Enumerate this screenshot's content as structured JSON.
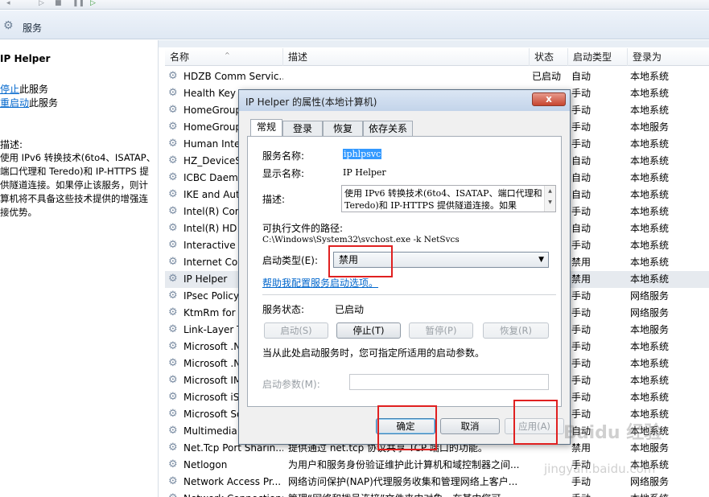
{
  "app": {
    "title": "服务"
  },
  "left": {
    "service_name": "IP Helper",
    "action_stop_link": "停止",
    "action_stop_suffix": "此服务",
    "action_restart_link": "重启动",
    "action_restart_suffix": "此服务",
    "desc_label": "描述:",
    "desc_text": "使用 IPv6 转换技术(6to4、ISATAP、端口代理和 Teredo)和 IP-HTTPS 提供隧道连接。如果停止该服务，则计算机将不具备这些技术提供的增强连接优势。"
  },
  "columns": {
    "name": "名称",
    "desc": "描述",
    "status": "状态",
    "startup": "启动类型",
    "logon": "登录为"
  },
  "services": [
    {
      "name": "HDZB Comm Servic...",
      "desc": "",
      "status": "已启动",
      "startup": "自动",
      "logon": "本地系统"
    },
    {
      "name": "Health Key a",
      "desc": "",
      "status": "",
      "startup": "手动",
      "logon": "本地系统"
    },
    {
      "name": "HomeGroup",
      "desc": "",
      "status": "",
      "startup": "手动",
      "logon": "本地系统"
    },
    {
      "name": "HomeGroup",
      "desc": "",
      "status": "",
      "startup": "手动",
      "logon": "本地服务"
    },
    {
      "name": "Human Inte",
      "desc": "",
      "status": "",
      "startup": "手动",
      "logon": "本地系统"
    },
    {
      "name": "HZ_DeviceSe",
      "desc": "",
      "status": "",
      "startup": "自动",
      "logon": "本地系统"
    },
    {
      "name": "ICBC Daemo",
      "desc": "",
      "status": "",
      "startup": "自动",
      "logon": "本地系统"
    },
    {
      "name": "IKE and Aut",
      "desc": "",
      "status": "",
      "startup": "自动",
      "logon": "本地系统"
    },
    {
      "name": "Intel(R) Con",
      "desc": "",
      "status": "",
      "startup": "手动",
      "logon": "本地系统"
    },
    {
      "name": "Intel(R) HD",
      "desc": "",
      "status": "",
      "startup": "自动",
      "logon": "本地系统"
    },
    {
      "name": "Interactive S",
      "desc": "",
      "status": "",
      "startup": "手动",
      "logon": "本地系统"
    },
    {
      "name": "Internet Cor",
      "desc": "",
      "status": "",
      "startup": "禁用",
      "logon": "本地系统"
    },
    {
      "name": "IP Helper",
      "desc": "",
      "status": "",
      "startup": "禁用",
      "logon": "本地系统"
    },
    {
      "name": "IPsec Policy",
      "desc": "",
      "status": "",
      "startup": "手动",
      "logon": "网络服务"
    },
    {
      "name": "KtmRm for",
      "desc": "",
      "status": "",
      "startup": "手动",
      "logon": "网络服务"
    },
    {
      "name": "Link-Layer T",
      "desc": "",
      "status": "",
      "startup": "手动",
      "logon": "本地服务"
    },
    {
      "name": "Microsoft .N",
      "desc": "",
      "status": "",
      "startup": "手动",
      "logon": "本地系统"
    },
    {
      "name": "Microsoft .N",
      "desc": "",
      "status": "",
      "startup": "手动",
      "logon": "本地系统"
    },
    {
      "name": "Microsoft IM",
      "desc": "",
      "status": "",
      "startup": "手动",
      "logon": "本地系统"
    },
    {
      "name": "Microsoft iS",
      "desc": "",
      "status": "",
      "startup": "手动",
      "logon": "本地系统"
    },
    {
      "name": "Microsoft So",
      "desc": "",
      "status": "",
      "startup": "手动",
      "logon": "本地系统"
    },
    {
      "name": "Multimedia",
      "desc": "",
      "status": "",
      "startup": "自动",
      "logon": "本地系统"
    },
    {
      "name": "Net.Tcp Port Sharin...",
      "desc": "提供通过 net.tcp 协议共享 TCP 端口的功能。",
      "status": "",
      "startup": "禁用",
      "logon": "本地服务"
    },
    {
      "name": "Netlogon",
      "desc": "为用户和服务身份验证维护此计算机和域控制器之间...",
      "status": "",
      "startup": "手动",
      "logon": "本地系统"
    },
    {
      "name": "Network Access Pr...",
      "desc": "网络访问保护(NAP)代理服务收集和管理网络上客户...",
      "status": "",
      "startup": "手动",
      "logon": "网络服务"
    },
    {
      "name": "Network Connections",
      "desc": "管理“网络和拨号连接”文件夹中对象，在其中您可",
      "status": "",
      "startup": "手动",
      "logon": "本地系统"
    }
  ],
  "dialog": {
    "title": "IP Helper 的属性(本地计算机)",
    "close": "x",
    "tabs": [
      "常规",
      "登录",
      "恢复",
      "依存关系"
    ],
    "service_name_label": "服务名称:",
    "service_name": "iphlpsvc",
    "display_name_label": "显示名称:",
    "display_name": "IP Helper",
    "desc_label": "描述:",
    "desc": "使用 IPv6 转换技术(6to4、ISATAP、端口代理和 Teredo)和 IP-HTTPS 提供隧道连接。如果",
    "path_label": "可执行文件的路径:",
    "path": "C:\\Windows\\System32\\svchost.exe -k NetSvcs",
    "startup_label": "启动类型(E):",
    "startup_value": "禁用",
    "help_link": "帮助我配置服务启动选项。",
    "status_label": "服务状态:",
    "status_value": "已启动",
    "btn_start": "启动(S)",
    "btn_stop": "停止(T)",
    "btn_pause": "暂停(P)",
    "btn_resume": "恢复(R)",
    "hint": "当从此处启动服务时，您可指定所适用的启动参数。",
    "param_label": "启动参数(M):",
    "param_value": "",
    "ok": "确定",
    "cancel": "取消",
    "apply": "应用(A)"
  },
  "watermark": {
    "main": "Baidu 经验",
    "sub": "jingyan.baidu.com"
  },
  "colors": {
    "annotation": "#e02020",
    "link": "#0066cc",
    "selection": "#3399ff"
  }
}
